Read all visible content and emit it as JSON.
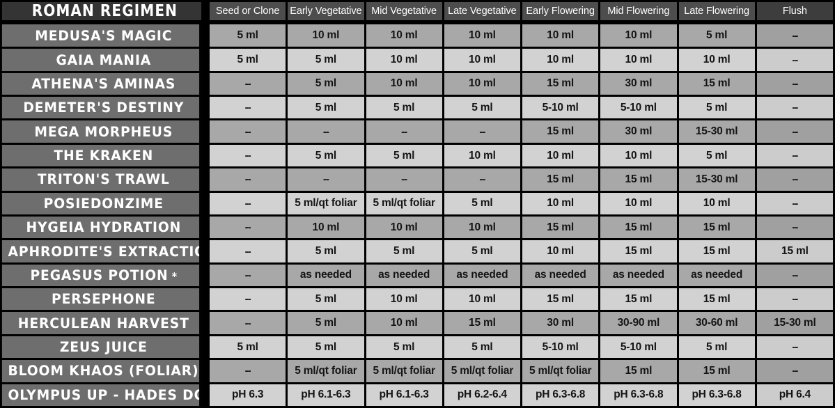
{
  "header": {
    "title": "ROMAN REGIMEN",
    "stages": [
      "Seed or Clone",
      "Early Vegetative",
      "Mid Vegetative",
      "Late Vegetative",
      "Early Flowering",
      "Mid Flowering",
      "Late Flowering",
      "Flush"
    ]
  },
  "colors": {
    "grid": "#000000",
    "title_bg": "#343434",
    "stage_header_bg": "#4d4d4d",
    "flush_header_bg": "#3d3d3d",
    "name_cell_bg": "#6e6e6e",
    "band_dark": "#a8a8a8",
    "band_light": "#d2d2d2",
    "text_light": "#ffffff",
    "text_dark": "#141414"
  },
  "rows": [
    {
      "name": "MEDUSA'S MAGIC",
      "values": [
        "5 ml",
        "10 ml",
        "10 ml",
        "10 ml",
        "10 ml",
        "10 ml",
        "5 ml",
        "--"
      ]
    },
    {
      "name": "GAIA MANIA",
      "values": [
        "5 ml",
        "5 ml",
        "10 ml",
        "10 ml",
        "10 ml",
        "10 ml",
        "10 ml",
        "--"
      ]
    },
    {
      "name": "ATHENA'S AMINAS",
      "values": [
        "--",
        "5 ml",
        "10 ml",
        "10 ml",
        "15 ml",
        "30 ml",
        "15 ml",
        "--"
      ]
    },
    {
      "name": "DEMETER'S DESTINY",
      "values": [
        "--",
        "5 ml",
        "5 ml",
        "5 ml",
        "5-10 ml",
        "5-10 ml",
        "5 ml",
        "--"
      ]
    },
    {
      "name": "MEGA MORPHEUS",
      "values": [
        "--",
        "--",
        "--",
        "--",
        "15 ml",
        "30 ml",
        "15-30 ml",
        "--"
      ]
    },
    {
      "name": "THE KRAKEN",
      "values": [
        "--",
        "5 ml",
        "5 ml",
        "10 ml",
        "10 ml",
        "10 ml",
        "5 ml",
        "--"
      ]
    },
    {
      "name": "TRITON'S TRAWL",
      "values": [
        "--",
        "--",
        "--",
        "--",
        "15 ml",
        "15 ml",
        "15-30 ml",
        "--"
      ]
    },
    {
      "name": "POSIEDONZIME",
      "values": [
        "--",
        "5 ml/qt foliar",
        "5 ml/qt foliar",
        "5 ml",
        "10 ml",
        "10 ml",
        "10 ml",
        "--"
      ]
    },
    {
      "name": "HYGEIA HYDRATION",
      "values": [
        "--",
        "10 ml",
        "10 ml",
        "10 ml",
        "15 ml",
        "15 ml",
        "15 ml",
        "--"
      ]
    },
    {
      "name": "APHRODITE'S EXTRACTION",
      "values": [
        "--",
        "5 ml",
        "5 ml",
        "5 ml",
        "10 ml",
        "15 ml",
        "15 ml",
        "15 ml"
      ]
    },
    {
      "name": "PEGASUS POTION *",
      "values": [
        "--",
        "as needed",
        "as needed",
        "as needed",
        "as needed",
        "as needed",
        "as needed",
        "--"
      ]
    },
    {
      "name": "PERSEPHONE",
      "values": [
        "--",
        "5 ml",
        "10 ml",
        "10 ml",
        "15 ml",
        "15 ml",
        "15 ml",
        "--"
      ]
    },
    {
      "name": "HERCULEAN HARVEST",
      "values": [
        "--",
        "5 ml",
        "10 ml",
        "15 ml",
        "30 ml",
        "30-90 ml",
        "30-60 ml",
        "15-30 ml"
      ]
    },
    {
      "name": "ZEUS JUICE",
      "values": [
        "5 ml",
        "5 ml",
        "5 ml",
        "5 ml",
        "5-10 ml",
        "5-10 ml",
        "5 ml",
        "--"
      ]
    },
    {
      "name": "BLOOM KHAOS (FOLIAR) **",
      "values": [
        "--",
        "5 ml/qt foliar",
        "5 ml/qt foliar",
        "5 ml/qt foliar",
        "5 ml/qt foliar",
        "15 ml",
        "15 ml",
        "--"
      ]
    },
    {
      "name": "OLYMPUS UP - HADES DOWN",
      "values": [
        "pH 6.3",
        "pH 6.1-6.3",
        "pH 6.1-6.3",
        "pH 6.2-6.4",
        "pH 6.3-6.8",
        "pH 6.3-6.8",
        "pH 6.3-6.8",
        "pH 6.4"
      ]
    }
  ]
}
